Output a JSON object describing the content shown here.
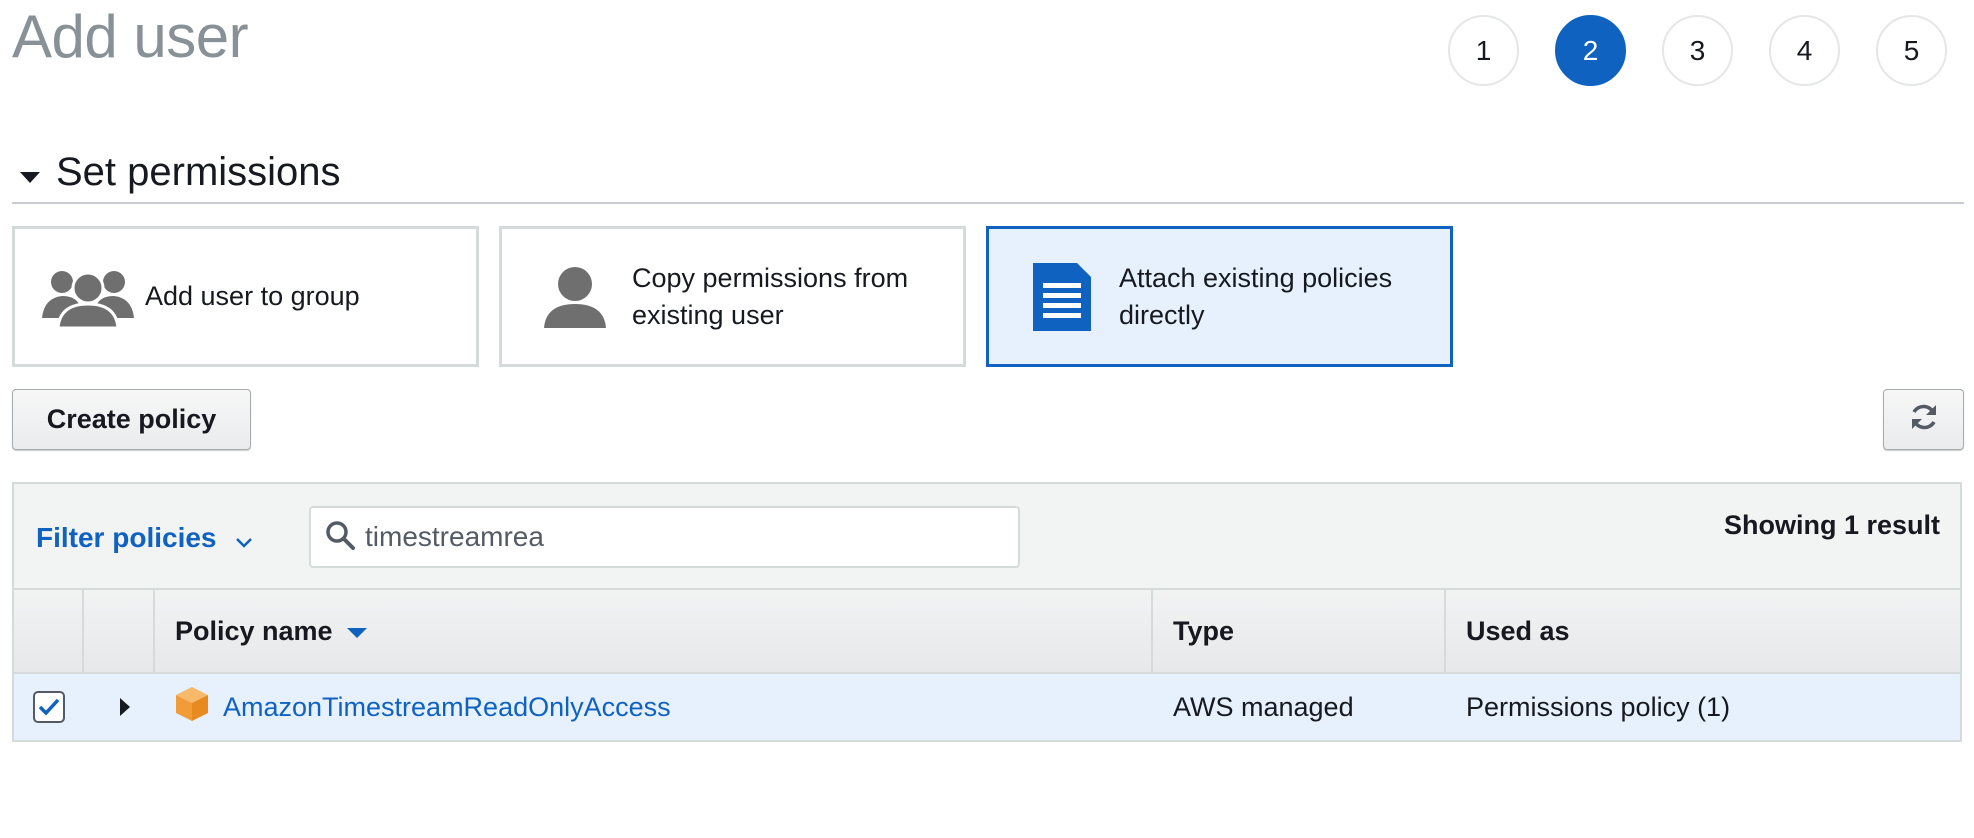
{
  "page": {
    "title": "Add user"
  },
  "steps": [
    {
      "label": "1",
      "active": false
    },
    {
      "label": "2",
      "active": true
    },
    {
      "label": "3",
      "active": false
    },
    {
      "label": "4",
      "active": false
    },
    {
      "label": "5",
      "active": false
    }
  ],
  "section": {
    "title": "Set permissions"
  },
  "tiles": [
    {
      "label": "Add user to group",
      "icon": "users-group-icon",
      "selected": false
    },
    {
      "label": "Copy permissions from existing user",
      "icon": "user-icon",
      "selected": false
    },
    {
      "label": "Attach existing policies directly",
      "icon": "document-icon",
      "selected": true
    }
  ],
  "toolbar": {
    "create_policy_label": "Create policy",
    "refresh_icon": "refresh-icon"
  },
  "filter": {
    "dropdown_label": "Filter policies",
    "search_value": "timestreamrea",
    "result_count": "Showing 1 result"
  },
  "table": {
    "columns": {
      "policy_name": "Policy name",
      "type": "Type",
      "used_as": "Used as"
    },
    "rows": [
      {
        "checked": true,
        "policy_name": "AmazonTimestreamReadOnlyAccess",
        "type": "AWS managed",
        "used_as": "Permissions policy (1)",
        "icon": "aws-cube-icon"
      }
    ]
  },
  "colors": {
    "accent": "#0f62c0",
    "selected_bg": "#e6f1fd",
    "title_gray": "#879196",
    "policy_icon": "#f19c38"
  }
}
